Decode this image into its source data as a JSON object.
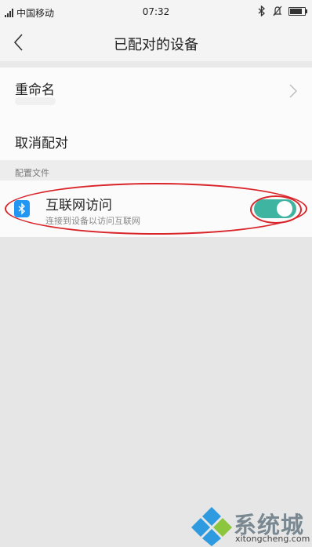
{
  "status_bar": {
    "carrier": "中国移动",
    "time": "07:32",
    "icons": [
      "signal-icon",
      "bluetooth-icon",
      "alarm-icon",
      "battery-icon"
    ]
  },
  "nav": {
    "title": "已配对的设备",
    "back_icon": "back-arrow-icon"
  },
  "settings": {
    "rename_label": "重命名",
    "unpair_label": "取消配对"
  },
  "profiles": {
    "section_label": "配置文件",
    "items": [
      {
        "title": "互联网访问",
        "subtitle": "连接到设备以访问互联网",
        "icon": "bluetooth-icon",
        "enabled": true
      }
    ]
  },
  "colors": {
    "toggle_on": "#3fb5a1",
    "bluetooth_blue": "#2196f3",
    "annotation_red": "#d9252a"
  },
  "watermark": {
    "title": "系统城",
    "url": "xitongcheng.com"
  }
}
